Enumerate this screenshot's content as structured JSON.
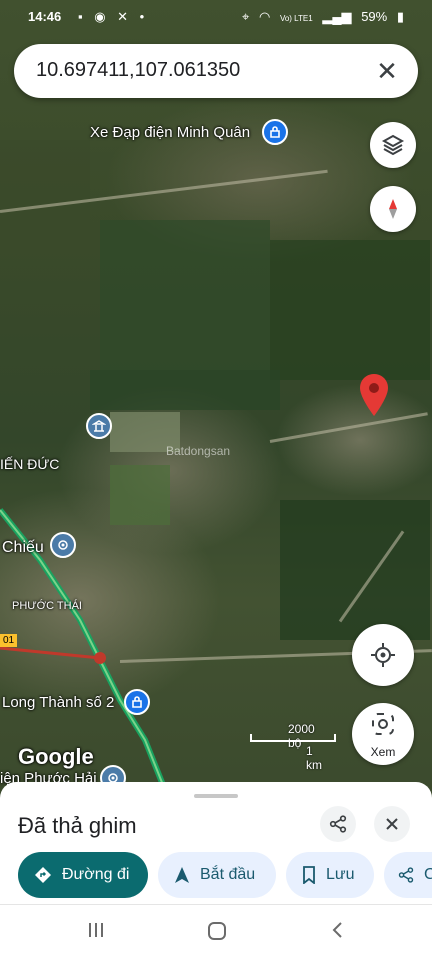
{
  "status_bar": {
    "time": "14:46",
    "notif_icons": "▪ ◉ ✕ •",
    "signal_label": "Vo) LTE1",
    "battery": "59%"
  },
  "search": {
    "query": "10.697411,107.061350"
  },
  "map": {
    "labels": {
      "shop": "Xe Đạp điện Minh Quân",
      "area1": "IẾN ĐỨC",
      "area2": "Chiếu",
      "area3": "PHƯỚC THÁI",
      "road_sign": "01",
      "area4": "Long Thành số 2",
      "area5": "iện Phước Hải"
    },
    "google_logo": "Google",
    "watermark": "Batdongsan",
    "scale": {
      "top": "2000 bộ",
      "bottom": "1 km"
    },
    "view_label": "Xem"
  },
  "sheet": {
    "title": "Đã thả ghim",
    "chips": {
      "directions": "Đường đi",
      "start": "Bắt đầu",
      "save": "Lưu",
      "share_partial": "C"
    }
  },
  "colors": {
    "accent": "#0b6b6f",
    "chip_bg": "#e8f0fe",
    "pin": "#e53935"
  }
}
